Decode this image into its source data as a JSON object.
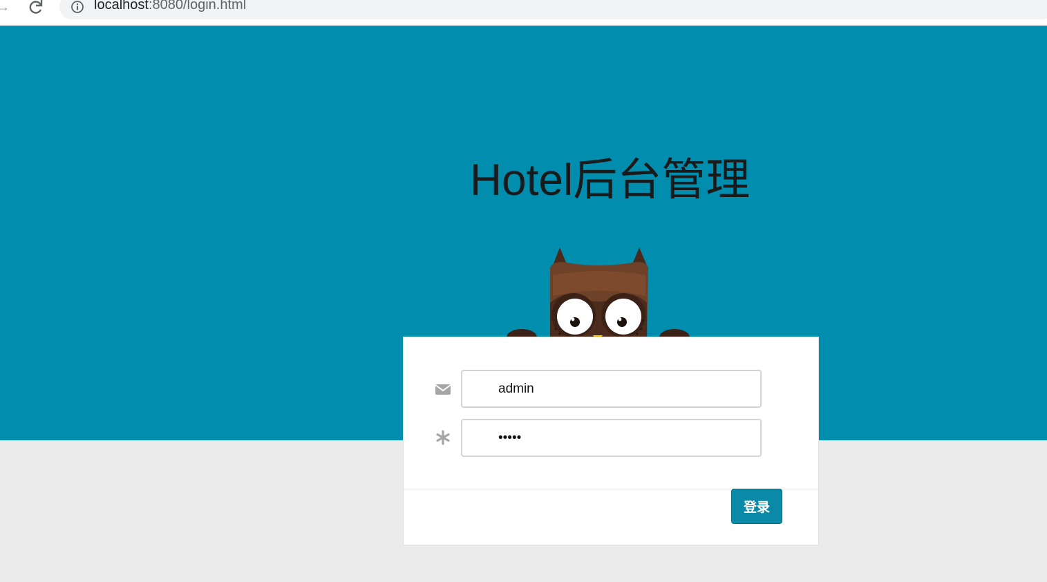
{
  "browser": {
    "url_host": "localhost",
    "url_rest": ":8080/login.html"
  },
  "page": {
    "title": "Hotel后台管理"
  },
  "login_form": {
    "username_value": "admin",
    "password_value": "12345",
    "submit_label": "登录"
  },
  "colors": {
    "hero_bg": "#008dae",
    "page_bg": "#ebebeb",
    "button_bg": "#0b8aa8",
    "owl_brown": "#6b4029"
  },
  "icons": {
    "username_field": "envelope-icon",
    "password_field": "asterisk-icon"
  }
}
